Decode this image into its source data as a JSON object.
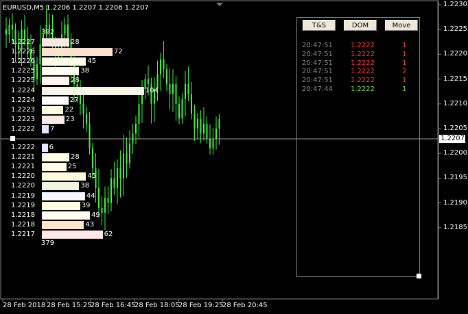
{
  "window": {
    "title": "EURUSD,M5  1.2206 1.2207 1.2206 1.2207"
  },
  "y_axis": {
    "current_price": "1.2207",
    "labels": [
      "1.2230",
      "1.2225",
      "1.2220",
      "1.2215",
      "1.2210",
      "1.2205",
      "1.2200",
      "1.2195",
      "1.2190",
      "1.2185"
    ]
  },
  "x_axis": {
    "labels": [
      "28 Feb 2018",
      "28 Feb 15:25",
      "28 Feb 16:45",
      "28 Feb 18:05",
      "28 Feb 19:25",
      "28 Feb 20:45"
    ]
  },
  "dom": {
    "ask_total": "392",
    "bid_total": "379",
    "asks": [
      {
        "price": "1.2227",
        "volume": "28",
        "vol_value": 28,
        "color": "#fde8e8"
      },
      {
        "price": "1.2226",
        "volume": "72",
        "vol_value": 72,
        "color": "#fde1cf"
      },
      {
        "price": "1.2226",
        "volume": "45",
        "vol_value": 45,
        "color": "#fffde5"
      },
      {
        "price": "1.2225",
        "volume": "38",
        "vol_value": 38,
        "color": "#fffdf2"
      },
      {
        "price": "1.2225",
        "volume": "28",
        "vol_value": 28,
        "color": "#fff7ee"
      },
      {
        "price": "1.2224",
        "volume": "104",
        "vol_value": 104,
        "color": "#f7f5e6"
      },
      {
        "price": "1.2224",
        "volume": "27",
        "vol_value": 27,
        "color": "#ffffff"
      },
      {
        "price": "1.2223",
        "volume": "22",
        "vol_value": 22,
        "color": "#fdfde6"
      },
      {
        "price": "1.2223",
        "volume": "23",
        "vol_value": 23,
        "color": "#fde9e5"
      },
      {
        "price": "1.2222",
        "volume": "7",
        "vol_value": 7,
        "color": "#e6e6ff"
      }
    ],
    "bids": [
      {
        "price": "1.2222",
        "volume": "6",
        "vol_value": 6,
        "color": "#e8e8ff"
      },
      {
        "price": "1.2221",
        "volume": "28",
        "vol_value": 28,
        "color": "#fffde8"
      },
      {
        "price": "1.2221",
        "volume": "25",
        "vol_value": 25,
        "color": "#fffde8"
      },
      {
        "price": "1.2220",
        "volume": "45",
        "vol_value": 45,
        "color": "#fffbdc"
      },
      {
        "price": "1.2220",
        "volume": "38",
        "vol_value": 38,
        "color": "#f4f4e4"
      },
      {
        "price": "1.2219",
        "volume": "44",
        "vol_value": 44,
        "color": "#f6f6ff"
      },
      {
        "price": "1.2219",
        "volume": "39",
        "vol_value": 39,
        "color": "#fffce2"
      },
      {
        "price": "1.2218",
        "volume": "49",
        "vol_value": 49,
        "color": "#fffef0"
      },
      {
        "price": "1.2218",
        "volume": "43",
        "vol_value": 43,
        "color": "#fde6cc"
      },
      {
        "price": "1.2217",
        "volume": "62",
        "vol_value": 62,
        "color": "#fde8e8"
      }
    ]
  },
  "panel": {
    "buttons": {
      "ts": "T&S",
      "dom": "DOM",
      "move": "Move"
    },
    "trades": [
      {
        "time": "20:47:51",
        "price": "1.2222",
        "volume": "1",
        "color": "#ff3c2a"
      },
      {
        "time": "20:47:51",
        "price": "1.2222",
        "volume": "1",
        "color": "#ff3c2a"
      },
      {
        "time": "20:47:51",
        "price": "1.2222",
        "volume": "1",
        "color": "#ff3c2a"
      },
      {
        "time": "20:47:51",
        "price": "1.2222",
        "volume": "2",
        "color": "#ff3c2a"
      },
      {
        "time": "20:47:51",
        "price": "1.2222",
        "volume": "1",
        "color": "#ff3c2a"
      },
      {
        "time": "20:47:44",
        "price": "1.2222",
        "volume": "1",
        "color": "#7fd44a"
      }
    ]
  },
  "colors": {
    "candle": "#33ff33",
    "frame": "#7f7f7f",
    "bg": "#000000"
  },
  "chart_data": {
    "type": "candlestick",
    "symbol": "EURUSD",
    "timeframe": "M5",
    "ylim": [
      1.2183,
      1.2232
    ],
    "close_path": [
      1.2224,
      1.2226,
      1.2225,
      1.2222,
      1.2221,
      1.2225,
      1.2223,
      1.2221,
      1.2219,
      1.2215,
      1.2218,
      1.2222,
      1.2224,
      1.2226,
      1.2225,
      1.2222,
      1.222,
      1.2221,
      1.2224,
      1.2226,
      1.2223,
      1.2218,
      1.2214,
      1.2212,
      1.221,
      1.2208,
      1.2206,
      1.2201,
      1.2197,
      1.2193,
      1.2189,
      1.2188,
      1.2191,
      1.219,
      1.2195,
      1.2193,
      1.2197,
      1.2195,
      1.22,
      1.2198,
      1.2202,
      1.2204,
      1.2206,
      1.221,
      1.2213,
      1.2215,
      1.2214,
      1.221,
      1.2213,
      1.2216,
      1.2219,
      1.2217,
      1.2214,
      1.2212,
      1.2214,
      1.221,
      1.2207,
      1.2211,
      1.2214,
      1.2212,
      1.2208,
      1.2205,
      1.2207,
      1.2204,
      1.2206,
      1.2203,
      1.2201,
      1.2203,
      1.2205,
      1.2207
    ]
  }
}
